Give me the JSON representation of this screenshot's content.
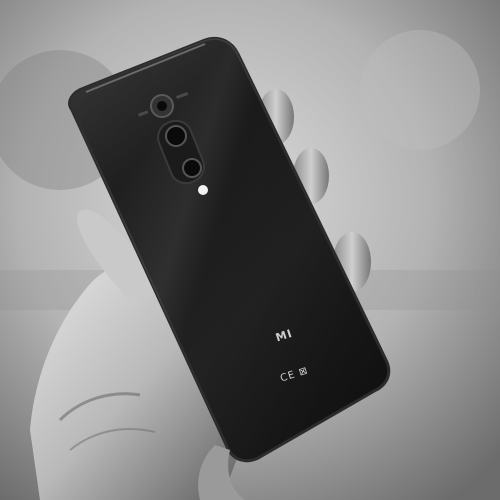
{
  "scene": {
    "palette": {
      "wall_light": "#d8d8d8",
      "wall_mid": "#a9a9a9",
      "wall_dark": "#6a6a6a",
      "skin_light": "#e2e2e2",
      "skin_mid": "#a8a8a8",
      "skin_dark": "#4a4a4a",
      "phone_body": "#141414",
      "phone_edge": "#2b2b2b",
      "phone_highlight": "#5a5a5a",
      "camera_ring": "#3a3a3a",
      "flash": "#f2f2f2"
    },
    "brand_logo": "MI",
    "certification_marks": "CE ⊠"
  }
}
